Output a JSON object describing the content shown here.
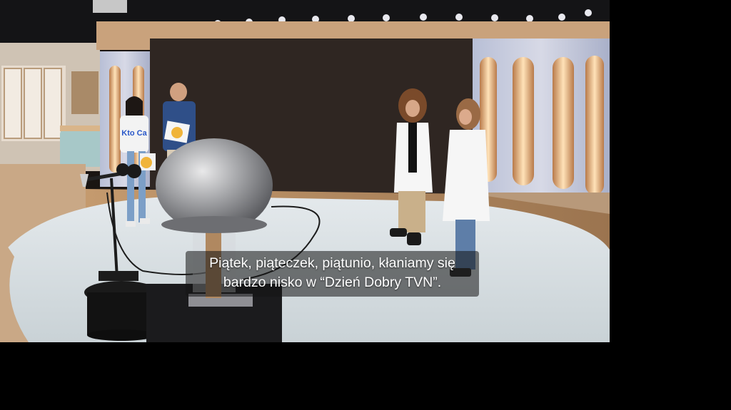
{
  "video": {
    "subtitle_lines": [
      "Piątek, piąteczek, piątunio, kłaniamy się",
      "bardzo nisko w “Dzień Dobry TVN”."
    ],
    "scene_text": {
      "tshirt_text": "Kto Ca"
    }
  },
  "colors": {
    "background": "#000000",
    "subtitle_text": "#ffffff",
    "subtitle_box": "#141414"
  }
}
